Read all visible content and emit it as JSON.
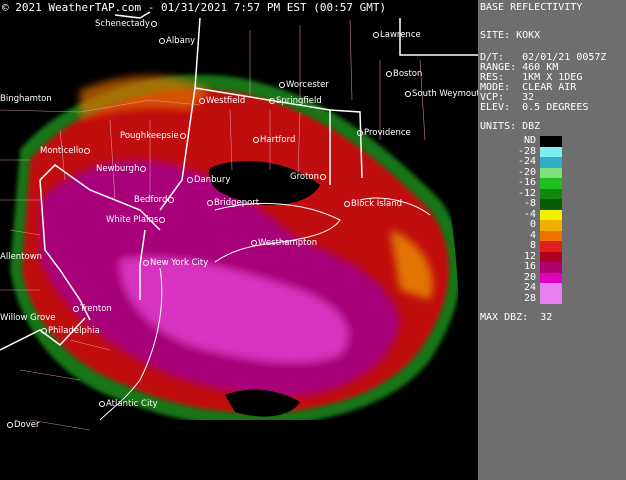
{
  "banner": "© 2021 WeatherTAP.com - 01/31/2021  7:57 PM EST (00:57 GMT)",
  "panel": {
    "title": "BASE REFLECTIVITY",
    "site_line": "SITE: KOKX",
    "dt_line": "D/T:   02/01/21 0057Z",
    "range_line": "RANGE: 460 KM",
    "res_line": "RES:   1KM X 1DEG",
    "mode_line": "MODE:  CLEAR AIR",
    "vcp_line": "VCP:   32",
    "elev_line": "ELEV:  0.5 DEGREES",
    "units_line": "UNITS: DBZ",
    "maxdbz_line": "MAX DBZ:  32"
  },
  "legend": {
    "labels": [
      "ND",
      "-28",
      "-24",
      "-20",
      "-16",
      "-12",
      "-8",
      "-4",
      "0",
      "4",
      "8",
      "12",
      "16",
      "20",
      "24",
      "28"
    ],
    "colors": [
      "#000000",
      "#7cf0f0",
      "#30b0c8",
      "#80e080",
      "#20c020",
      "#108810",
      "#0a5a0a",
      "#f0f000",
      "#f0b000",
      "#f07000",
      "#e02020",
      "#b00020",
      "#b00070",
      "#e000c0",
      "#e880f0",
      "#e880f0"
    ]
  },
  "cities": [
    {
      "name": "Schenectady",
      "dot": "right"
    },
    {
      "name": "Albany",
      "dot": "left"
    },
    {
      "name": "Lawrence",
      "dot": "left"
    },
    {
      "name": "Worcester",
      "dot": "left"
    },
    {
      "name": "Boston",
      "dot": "left"
    },
    {
      "name": "South Weymouth",
      "dot": "left"
    },
    {
      "name": "Binghamton",
      "dot": "none"
    },
    {
      "name": "Westfield",
      "dot": "left"
    },
    {
      "name": "Springfield",
      "dot": "left"
    },
    {
      "name": "Providence",
      "dot": "left"
    },
    {
      "name": "Poughkeepsie",
      "dot": "right"
    },
    {
      "name": "Hartford",
      "dot": "left"
    },
    {
      "name": "Monticello",
      "dot": "right"
    },
    {
      "name": "Newburgh",
      "dot": "right"
    },
    {
      "name": "Danbury",
      "dot": "left"
    },
    {
      "name": "Groton",
      "dot": "right"
    },
    {
      "name": "Bedford",
      "dot": "right"
    },
    {
      "name": "Bridgeport",
      "dot": "left"
    },
    {
      "name": "Block Island",
      "dot": "left"
    },
    {
      "name": "White Plains",
      "dot": "right"
    },
    {
      "name": "Westhampton",
      "dot": "left"
    },
    {
      "name": "Allentown",
      "dot": "none"
    },
    {
      "name": "New York City",
      "dot": "left"
    },
    {
      "name": "Trenton",
      "dot": "left"
    },
    {
      "name": "Willow Grove",
      "dot": "none"
    },
    {
      "name": "Philadelphia",
      "dot": "left"
    },
    {
      "name": "Atlantic City",
      "dot": "left"
    },
    {
      "name": "Dover",
      "dot": "left"
    }
  ]
}
